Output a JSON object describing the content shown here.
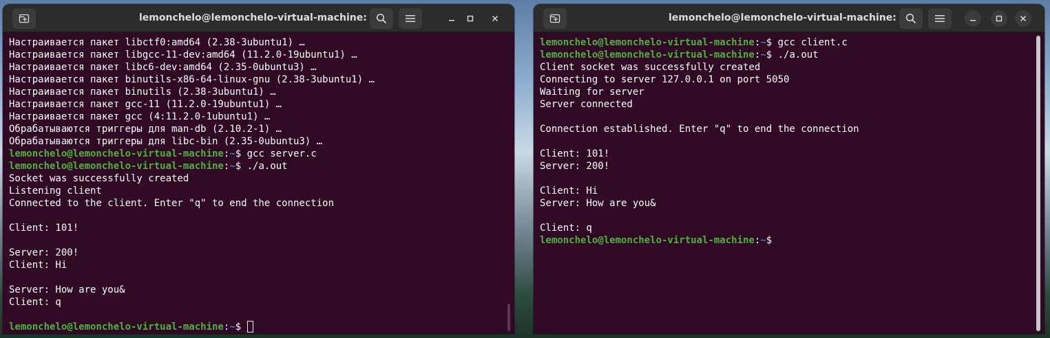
{
  "colors": {
    "terminal_bg": "#300a24",
    "titlebar_bg": "#2c2c2c",
    "prompt_user": "#4fb33a",
    "prompt_path": "#3d7dd0",
    "text": "#ffffff"
  },
  "left_window": {
    "title": "lemonchelo@lemonchelo-virtual-machine: ~",
    "icons": {
      "new_tab": "new-tab-icon",
      "search": "search-icon",
      "menu": "hamburger-menu-icon",
      "minimize": "minimize-icon",
      "maximize": "maximize-icon",
      "close": "close-icon"
    },
    "lines": [
      {
        "text": "Настраивается пакет libctf0:amd64 (2.38-3ubuntu1) …"
      },
      {
        "text": "Настраивается пакет libgcc-11-dev:amd64 (11.2.0-19ubuntu1) …"
      },
      {
        "text": "Настраивается пакет libc6-dev:amd64 (2.35-0ubuntu3) …"
      },
      {
        "text": "Настраивается пакет binutils-x86-64-linux-gnu (2.38-3ubuntu1) …"
      },
      {
        "text": "Настраивается пакет binutils (2.38-3ubuntu1) …"
      },
      {
        "text": "Настраивается пакет gcc-11 (11.2.0-19ubuntu1) …"
      },
      {
        "text": "Настраивается пакет gcc (4:11.2.0-1ubuntu1) …"
      },
      {
        "text": "Обрабатываются триггеры для man-db (2.10.2-1) …"
      },
      {
        "text": "Обрабатываются триггеры для libc-bin (2.35-0ubuntu3) …"
      },
      {
        "prompt_user": "lemonchelo@lemonchelo-virtual-machine",
        "prompt_colon": ":",
        "prompt_path": "~",
        "prompt_dollar": "$ ",
        "command": "gcc server.c"
      },
      {
        "prompt_user": "lemonchelo@lemonchelo-virtual-machine",
        "prompt_colon": ":",
        "prompt_path": "~",
        "prompt_dollar": "$ ",
        "command": "./a.out"
      },
      {
        "text": "Socket was successfully created"
      },
      {
        "text": "Listening client"
      },
      {
        "text": "Connected to the client. Enter \"q\" to end the connection"
      },
      {
        "text": ""
      },
      {
        "text": "Client: 101!"
      },
      {
        "text": ""
      },
      {
        "text": "Server: 200!"
      },
      {
        "text": "Client: Hi"
      },
      {
        "text": ""
      },
      {
        "text": "Server: How are you&"
      },
      {
        "text": "Client: q"
      },
      {
        "text": ""
      },
      {
        "prompt_user": "lemonchelo@lemonchelo-virtual-machine",
        "prompt_colon": ":",
        "prompt_path": "~",
        "prompt_dollar": "$ ",
        "command": ""
      }
    ]
  },
  "right_window": {
    "title": "lemonchelo@lemonchelo-virtual-machine: ~",
    "icons": {
      "new_tab": "new-tab-icon",
      "search": "search-icon",
      "menu": "hamburger-menu-icon",
      "minimize": "minimize-icon",
      "maximize": "maximize-icon",
      "close": "close-icon"
    },
    "lines": [
      {
        "prompt_user": "lemonchelo@lemonchelo-virtual-machine",
        "prompt_colon": ":",
        "prompt_path": "~",
        "prompt_dollar": "$ ",
        "command": "gcc client.c"
      },
      {
        "prompt_user": "lemonchelo@lemonchelo-virtual-machine",
        "prompt_colon": ":",
        "prompt_path": "~",
        "prompt_dollar": "$ ",
        "command": "./a.out"
      },
      {
        "text": "Client socket was successfully created"
      },
      {
        "text": "Connecting to server 127.0.0.1 on port 5050"
      },
      {
        "text": "Waiting for server"
      },
      {
        "text": "Server connected"
      },
      {
        "text": ""
      },
      {
        "text": "Connection established. Enter \"q\" to end the connection"
      },
      {
        "text": ""
      },
      {
        "text": "Client: 101!"
      },
      {
        "text": "Server: 200!"
      },
      {
        "text": ""
      },
      {
        "text": "Client: Hi"
      },
      {
        "text": "Server: How are you&"
      },
      {
        "text": ""
      },
      {
        "text": "Client: q"
      },
      {
        "prompt_user": "lemonchelo@lemonchelo-virtual-machine",
        "prompt_colon": ":",
        "prompt_path": "~",
        "prompt_dollar": "$",
        "command": ""
      }
    ]
  }
}
